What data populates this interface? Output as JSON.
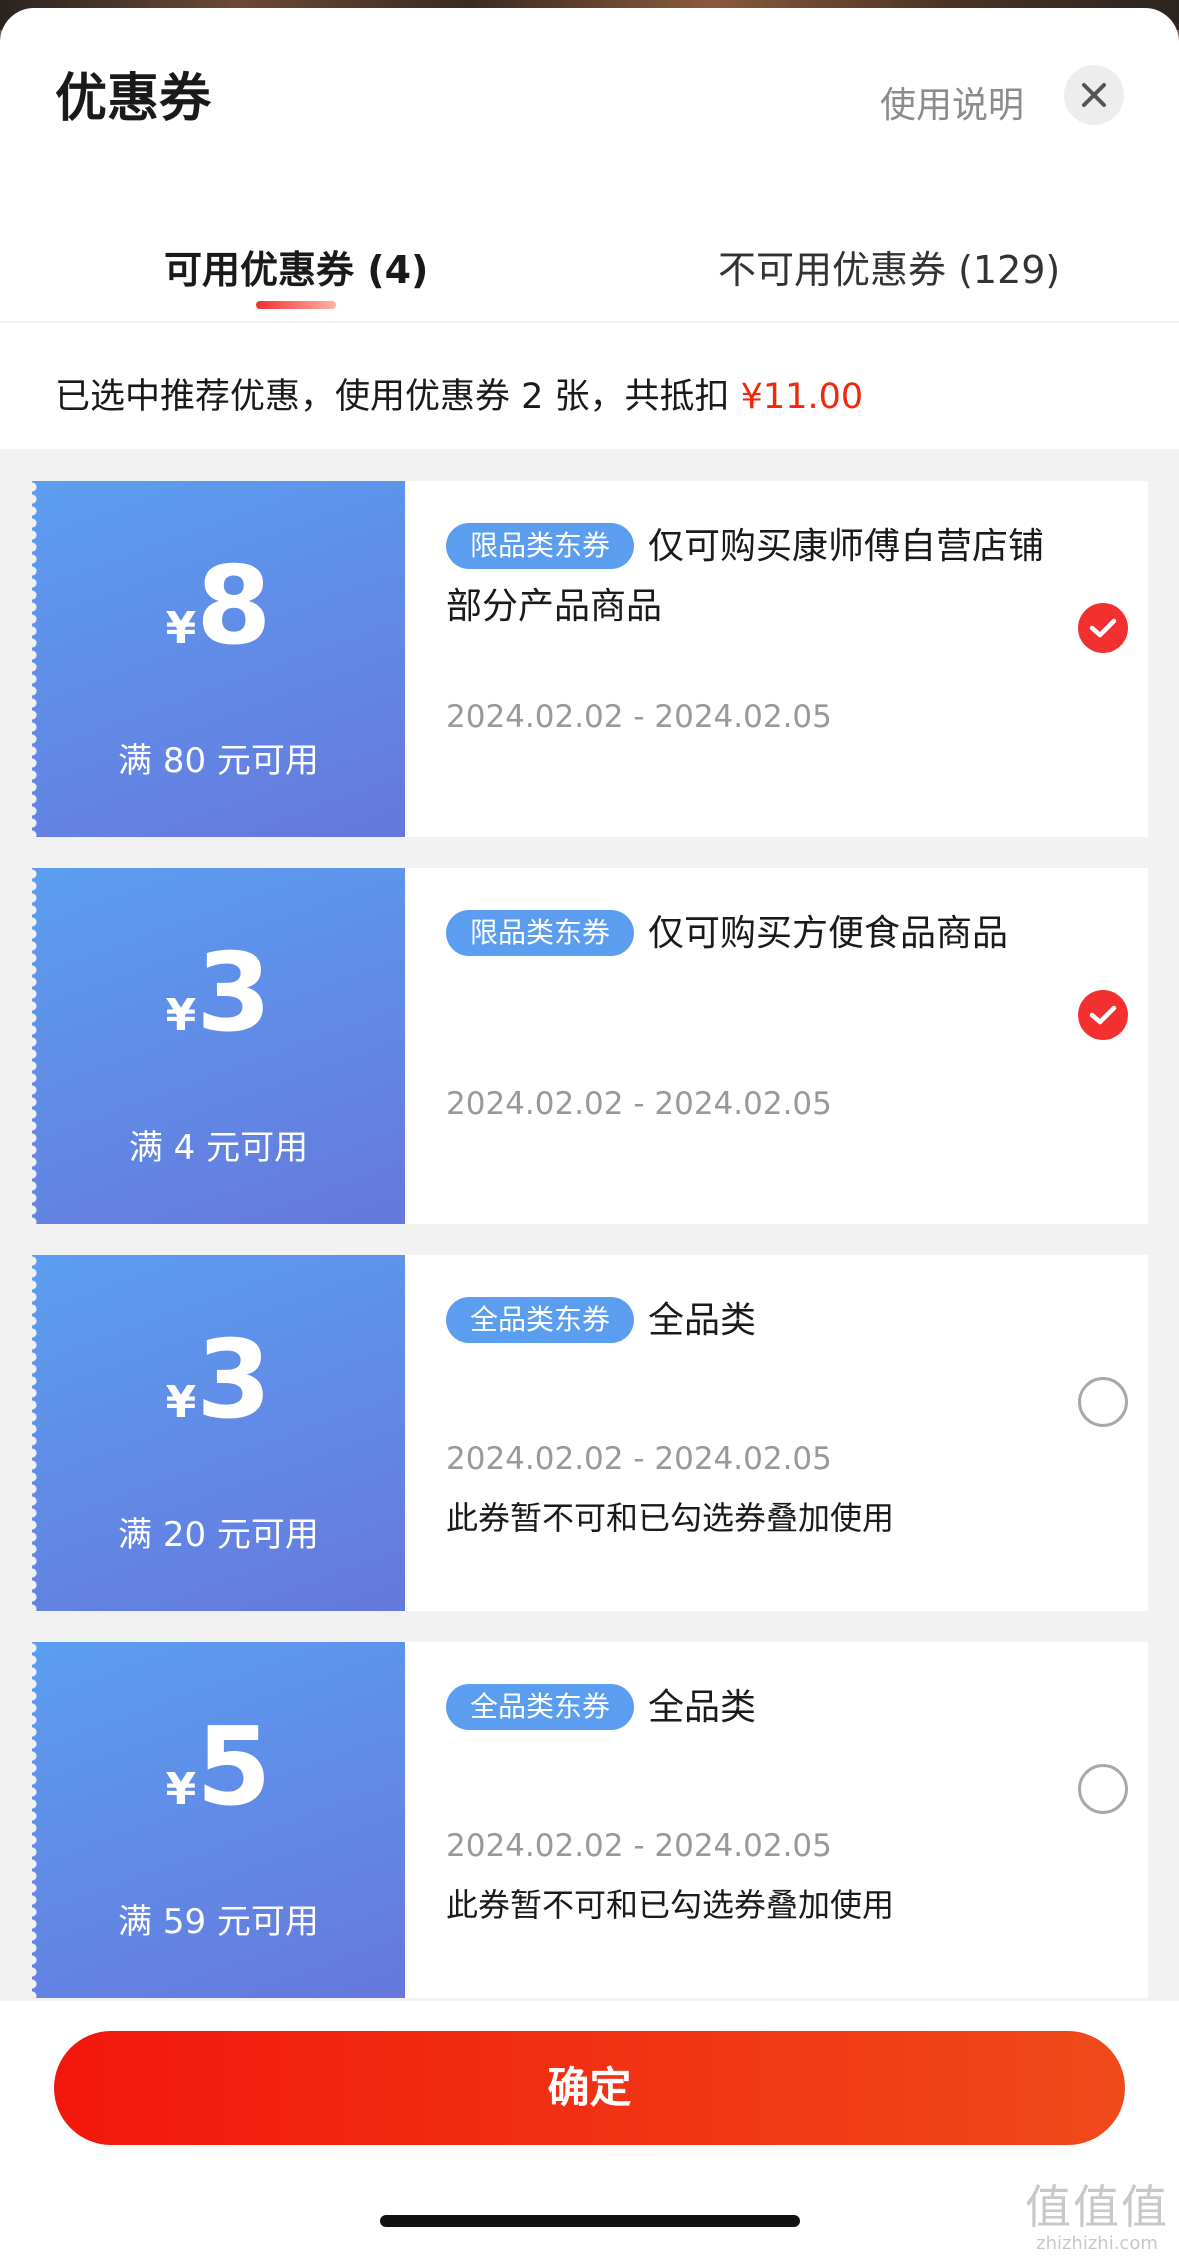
{
  "header": {
    "title": "优惠券",
    "help_label": "使用说明"
  },
  "tabs": [
    {
      "label": "可用优惠券 (4)",
      "active": true
    },
    {
      "label": "不可用优惠券 (129)",
      "active": false
    }
  ],
  "summary": {
    "text": "已选中推荐优惠，使用优惠券 2 张，共抵扣 ",
    "amount": "¥11.00"
  },
  "coupons": [
    {
      "currency": "¥",
      "amount": "8",
      "condition": "满 80 元可用",
      "badge": "限品类东券",
      "description": "仅可购买康师傅自营店铺部分产品商品",
      "date_range": "2024.02.02 - 2024.02.05",
      "note": "",
      "selected": true
    },
    {
      "currency": "¥",
      "amount": "3",
      "condition": "满 4 元可用",
      "badge": "限品类东券",
      "description": "仅可购买方便食品商品",
      "date_range": "2024.02.02 - 2024.02.05",
      "note": "",
      "selected": true
    },
    {
      "currency": "¥",
      "amount": "3",
      "condition": "满 20 元可用",
      "badge": "全品类东券",
      "description": "全品类",
      "date_range": "2024.02.02 - 2024.02.05",
      "note": "此券暂不可和已勾选券叠加使用",
      "selected": false
    },
    {
      "currency": "¥",
      "amount": "5",
      "condition": "满 59 元可用",
      "badge": "全品类东券",
      "description": "全品类",
      "date_range": "2024.02.02 - 2024.02.05",
      "note": "此券暂不可和已勾选券叠加使用",
      "selected": false
    }
  ],
  "footer": {
    "confirm_label": "确定"
  },
  "watermark": {
    "glyphs": "值值值",
    "site": "zhizhizhi.com"
  },
  "colors": {
    "accent": "#f2270c",
    "coupon_blue": "#5b9ef0",
    "check_red": "#f23030"
  }
}
